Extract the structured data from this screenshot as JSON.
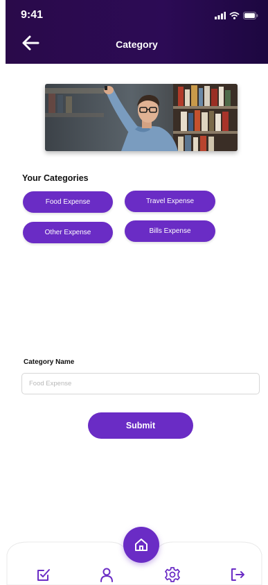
{
  "status_bar": {
    "time": "9:41"
  },
  "header": {
    "title": "Category"
  },
  "categories": {
    "heading": "Your Categories",
    "items": [
      {
        "label": "Food Expense"
      },
      {
        "label": "Travel Expense"
      },
      {
        "label": "Other Expense"
      },
      {
        "label": "Bills Expense"
      }
    ]
  },
  "form": {
    "field_label": "Category Name",
    "field_placeholder": "Food Expense",
    "field_value": "",
    "submit_label": "Submit"
  },
  "bottom_nav": {
    "items": [
      {
        "icon": "checkbox-edit-icon"
      },
      {
        "icon": "user-icon"
      },
      {
        "icon": "home-icon"
      },
      {
        "icon": "gear-icon"
      },
      {
        "icon": "logout-icon"
      }
    ]
  },
  "colors": {
    "header_bg": "#2a0a4a",
    "accent": "#6a2cc5"
  }
}
